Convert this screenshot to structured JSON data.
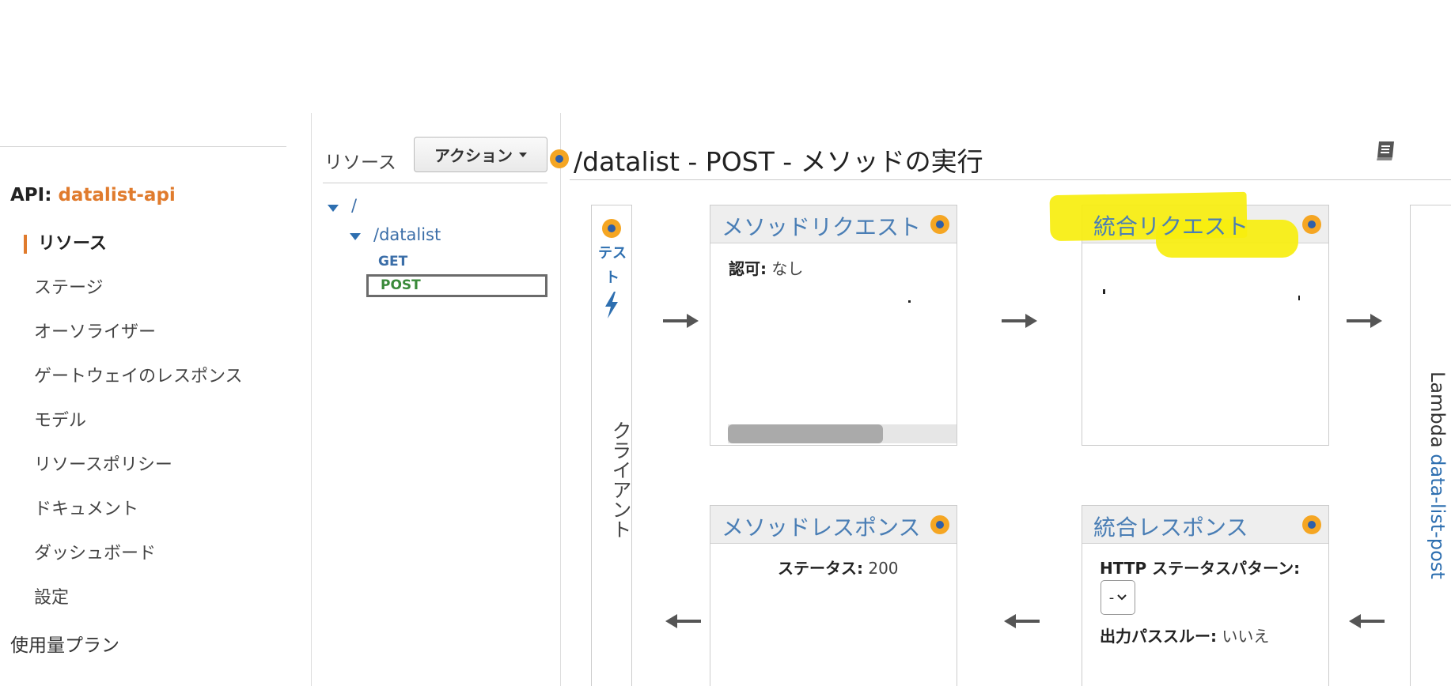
{
  "nav": {
    "api_label": "API:",
    "api_name": "datalist-api",
    "items": [
      {
        "label": "リソース",
        "active": true
      },
      {
        "label": "ステージ"
      },
      {
        "label": "オーソライザー"
      },
      {
        "label": "ゲートウェイのレスポンス"
      },
      {
        "label": "モデル"
      },
      {
        "label": "リソースポリシー"
      },
      {
        "label": "ドキュメント"
      },
      {
        "label": "ダッシュボード"
      },
      {
        "label": "設定"
      }
    ],
    "usage_plans": "使用量プラン"
  },
  "resources": {
    "label": "リソース",
    "actions_button": "アクション",
    "tree": {
      "root": "/",
      "child": "/datalist",
      "methods": [
        "GET",
        "POST"
      ]
    }
  },
  "execution": {
    "title": "/datalist - POST - メソッドの実行",
    "client": {
      "test_link": "テスト",
      "label": "クライアント"
    },
    "method_request": {
      "title": "メソッドリクエスト",
      "auth_label": "認可:",
      "auth_value": "なし"
    },
    "integration_request": {
      "title": "統合リクエスト"
    },
    "method_response": {
      "title": "メソッドレスポンス",
      "status_label": "ステータス:",
      "status_value": "200"
    },
    "integration_response": {
      "title": "統合レスポンス",
      "status_pattern_label": "HTTP ステータスパターン:",
      "status_pattern_value": "-",
      "output_passthrough_label": "出力パススルー:",
      "output_passthrough_value": "いいえ"
    },
    "lambda": {
      "label": "Lambda",
      "function_name": "data-list-post"
    }
  },
  "colors": {
    "accent_orange": "#e07b2d",
    "link_blue": "#2e6fb0",
    "post_green": "#3a8a3a",
    "highlight_yellow": "#f7ee0e"
  }
}
